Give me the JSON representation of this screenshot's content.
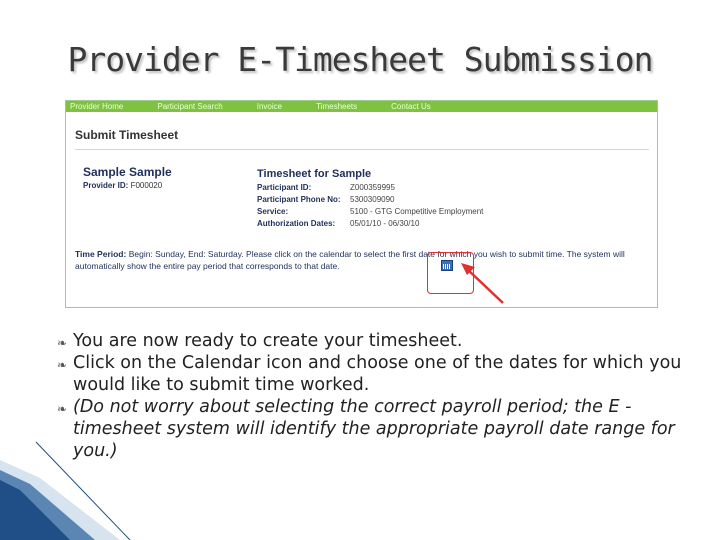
{
  "slide": {
    "title": "Provider E-Timesheet Submission"
  },
  "screenshot": {
    "nav": [
      "Provider Home",
      "Participant Search",
      "Invoice",
      "Timesheets",
      "Contact Us"
    ],
    "panel_title": "Submit Timesheet",
    "participant_name": "Sample  Sample",
    "provider_id_label": "Provider ID:",
    "provider_id_value": "F000020",
    "timesheet_title": "Timesheet for  Sample",
    "fields": [
      {
        "label": "Participant ID:",
        "value": "Z000359995"
      },
      {
        "label": "Participant Phone No:",
        "value": "5300309090"
      },
      {
        "label": "Service:",
        "value": "5100 - GTG Competitive Employment"
      },
      {
        "label": "Authorization Dates:",
        "value": "05/01/10 - 06/30/10"
      }
    ],
    "time_period_label": "Time Period:",
    "time_period_text": " Begin: Sunday, End: Saturday. Please click on the calendar to select the first date for which you wish to submit time. The system will automatically show the entire pay period that corresponds to that date.",
    "highlight_color": "#e03030",
    "nav_color": "#7fc241"
  },
  "bullets": [
    {
      "text": "You are now ready to create your timesheet.",
      "italic": false
    },
    {
      "text": "Click on the Calendar icon and choose one of the dates for which you would like to submit time worked.",
      "italic": false
    },
    {
      "text": "(Do not worry about selecting the correct payroll period; the E -timesheet system will identify the appropriate payroll date range for you.)",
      "italic": true
    }
  ]
}
